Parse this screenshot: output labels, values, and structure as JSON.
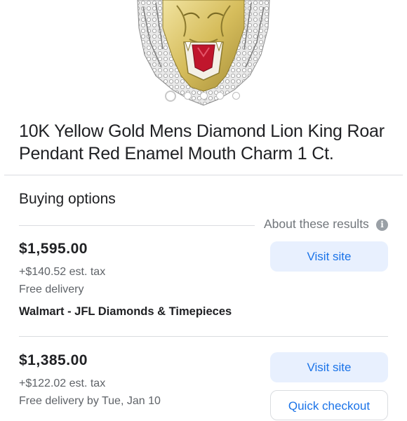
{
  "product": {
    "title": "10K Yellow Gold Mens Diamond Lion King Roar Pendant Red Enamel Mouth Charm 1 Ct.",
    "image_dots": 5,
    "active_dot": 0
  },
  "buying_options": {
    "heading": "Buying options",
    "about_results": "About these results",
    "about_icon": "info-icon"
  },
  "offers": [
    {
      "price": "$1,595.00",
      "tax": "+$140.52 est. tax",
      "delivery": "Free delivery",
      "seller": "Walmart - JFL Diamonds & Timepieces",
      "primary_button": "Visit site"
    },
    {
      "price": "$1,385.00",
      "tax": "+$122.02 est. tax",
      "delivery": "Free delivery by Tue, Jan 10",
      "primary_button": "Visit site",
      "secondary_button": "Quick checkout"
    }
  ],
  "colors": {
    "accent": "#1a73e8",
    "button_bg": "#e8f0fe",
    "divider": "#dadce0",
    "gold": "#d9c36a",
    "enamel_red": "#c0162c"
  }
}
